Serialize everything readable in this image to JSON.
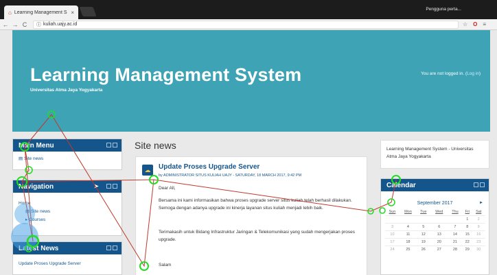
{
  "browser": {
    "tab_title": "Learning Management S",
    "tab_close": "×",
    "profile": "Pengguna perta...",
    "url": "kuliah.uajy.ac.id",
    "nav": {
      "back": "←",
      "forward": "→",
      "reload": "C"
    },
    "icons": {
      "star": "☆",
      "opera": "O",
      "menu": "≡",
      "info": "ⓘ"
    }
  },
  "header": {
    "title": "Learning Management System",
    "subtitle": "Universitas Atma Jaya Yogyakarta",
    "login_text": "You are not logged in. (",
    "login_link": "Log in",
    "login_close": ")"
  },
  "main_menu": {
    "title": "Main Menu",
    "items": [
      "Site news"
    ]
  },
  "navigation": {
    "title": "Navigation",
    "items": [
      "Home",
      "Site news",
      "Courses"
    ]
  },
  "latest_news": {
    "title": "Latest News",
    "items": [
      "Update Proses Upgrade Server"
    ]
  },
  "site_news": {
    "heading": "Site news",
    "post": {
      "title": "Update Proses Upgrade Server",
      "meta": "by ADMINISTRATOR SITUS KULIAH UAJY - SATURDAY, 18 MARCH 2017, 9:42 PM",
      "p1": "Dear All,",
      "p2": "Bersama ini kami informasikan bahwa proses upgrade server situs kuliah telah berhasil dilakukan. Semoga dengan adanya upgrade ini kinerja layanan situs kuliah menjadi lebih baik.",
      "p3": "Terimakasih untuk Bidang Infrastruktur Jaringan & Telekomunikasi yang sudah mengerjakan proses upgrade.",
      "p4": "Salam"
    }
  },
  "calendar_info": "Learning Management System - Universitas Atma Jaya Yogyakarta",
  "calendar": {
    "title": "Calendar",
    "month": "September 2017",
    "next": "►",
    "days": [
      "Sun",
      "Mon",
      "Tue",
      "Wed",
      "Thu",
      "Fri",
      "Sat"
    ],
    "weeks": [
      [
        "",
        "",
        "",
        "",
        "",
        "1",
        "2"
      ],
      [
        "3",
        "4",
        "5",
        "6",
        "7",
        "8",
        "9"
      ],
      [
        "10",
        "11",
        "12",
        "13",
        "14",
        "15",
        "16"
      ],
      [
        "17",
        "18",
        "19",
        "20",
        "21",
        "22",
        "23"
      ],
      [
        "24",
        "25",
        "26",
        "27",
        "28",
        "29",
        "30"
      ]
    ]
  },
  "colors": {
    "banner": "#3fa3b6",
    "block_header": "#14558c",
    "gaze_line": "#c0392b",
    "gaze_fixation": "#22dd22"
  }
}
